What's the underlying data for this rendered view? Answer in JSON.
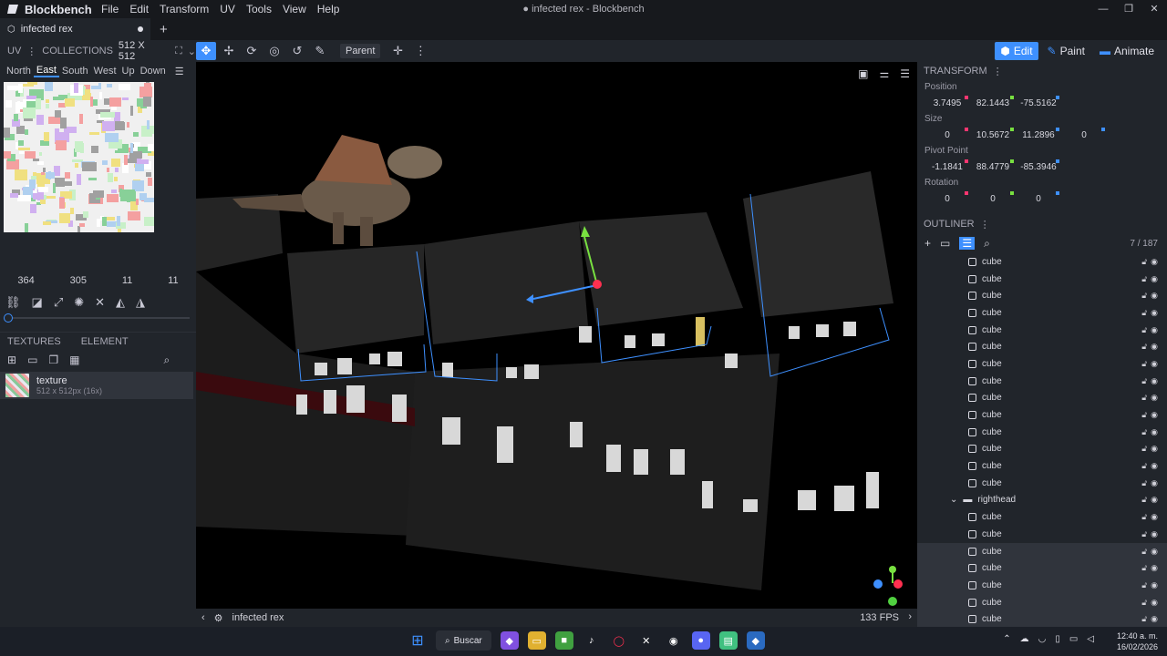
{
  "app": {
    "name": "Blockbench",
    "window_title": "● infected rex - Blockbench"
  },
  "menu": [
    "File",
    "Edit",
    "Transform",
    "UV",
    "Tools",
    "View",
    "Help"
  ],
  "tabs": {
    "active": "infected rex",
    "new_tab": "+"
  },
  "uv_panel": {
    "label": "UV",
    "collections": "COLLECTIONS",
    "resolution": "512 X 512",
    "faces": [
      "North",
      "East",
      "South",
      "West",
      "Up",
      "Down"
    ],
    "active_face": "East",
    "dims": [
      "364",
      "305",
      "11",
      "11"
    ]
  },
  "toolbar": {
    "pivot_mode": "Parent"
  },
  "modes": [
    {
      "label": "Edit",
      "icon": "edit-icon",
      "active": true
    },
    {
      "label": "Paint",
      "icon": "paint-icon",
      "active": false
    },
    {
      "label": "Animate",
      "icon": "animate-icon",
      "active": false
    }
  ],
  "textures_panel": {
    "tab_textures": "TEXTURES",
    "tab_element": "ELEMENT",
    "texture": {
      "name": "texture",
      "size": "512 x 512px (16x)"
    }
  },
  "viewport": {
    "model_name": "infected rex",
    "fps": "133 FPS"
  },
  "transform": {
    "title": "TRANSFORM",
    "position_label": "Position",
    "position": [
      "3.7495",
      "82.1443",
      "-75.5162"
    ],
    "size_label": "Size",
    "size": [
      "0",
      "10.5672",
      "11.2896",
      "0"
    ],
    "pivot_label": "Pivot Point",
    "pivot": [
      "-1.1841",
      "88.4779",
      "-85.3946"
    ],
    "rotation_label": "Rotation",
    "rotation": [
      "0",
      "0",
      "0"
    ]
  },
  "outliner": {
    "title": "OUTLINER",
    "count": "7 / 187",
    "items": [
      "cube",
      "cube",
      "cube",
      "cube",
      "cube",
      "cube",
      "cube",
      "cube",
      "cube",
      "cube",
      "cube",
      "cube",
      "cube",
      "cube"
    ],
    "group": "righthead",
    "group_items": [
      "cube",
      "cube",
      "cube",
      "cube",
      "cube",
      "cube",
      "cube"
    ]
  },
  "taskbar": {
    "search": "Buscar",
    "time": "12:40 a. m.",
    "date": "16/02/2026"
  },
  "colors": {
    "accent": "#3e90ff",
    "x_axis": "#ff3670",
    "y_axis": "#78e040",
    "z_axis": "#3e90ff"
  }
}
